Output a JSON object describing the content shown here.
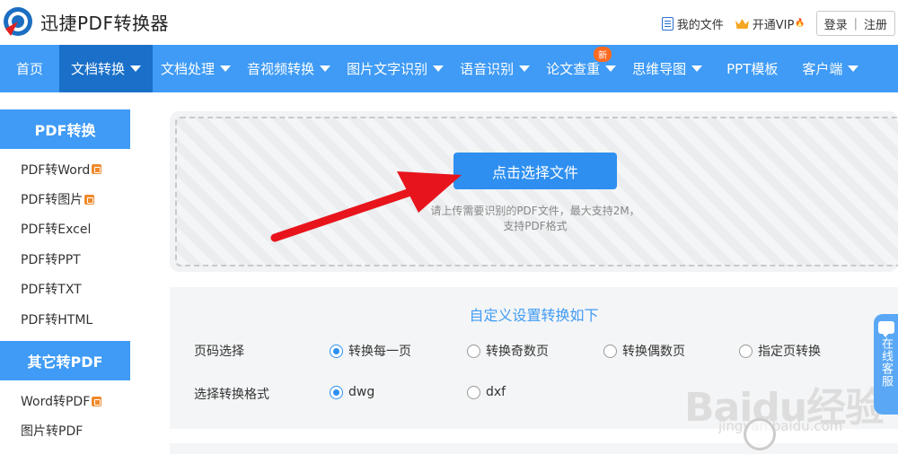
{
  "header": {
    "brand": "迅捷PDF转换器",
    "my_files": "我的文件",
    "vip": "开通VIP",
    "login": "登录",
    "divider": "|",
    "register": "注册"
  },
  "nav": {
    "items": [
      {
        "label": "首页",
        "caret": false
      },
      {
        "label": "文档转换",
        "caret": true,
        "active": true
      },
      {
        "label": "文档处理",
        "caret": true
      },
      {
        "label": "音视频转换",
        "caret": true
      },
      {
        "label": "图片文字识别",
        "caret": true
      },
      {
        "label": "语音识别",
        "caret": true
      },
      {
        "label": "论文查重",
        "caret": true,
        "badge": "新"
      },
      {
        "label": "思维导图",
        "caret": true
      },
      {
        "label": "PPT模板",
        "caret": false
      },
      {
        "label": "客户端",
        "caret": true
      }
    ]
  },
  "sidebar": {
    "pdf_convert_title": "PDF转换",
    "pdf_items": [
      {
        "label": "PDF转Word",
        "vip": true
      },
      {
        "label": "PDF转图片",
        "vip": true
      },
      {
        "label": "PDF转Excel",
        "vip": false
      },
      {
        "label": "PDF转PPT",
        "vip": false
      },
      {
        "label": "PDF转TXT",
        "vip": false
      },
      {
        "label": "PDF转HTML",
        "vip": false
      }
    ],
    "other_title": "其它转PDF",
    "other_items": [
      {
        "label": "Word转PDF",
        "vip": true
      },
      {
        "label": "图片转PDF",
        "vip": false
      }
    ]
  },
  "upload": {
    "button": "点击选择文件",
    "hint_line1": "请上传需要识别的PDF文件，最大支持2M，",
    "hint_line2": "支持PDF格式"
  },
  "settings": {
    "title": "自定义设置转换如下",
    "page_label": "页码选择",
    "page_options": [
      "转换每一页",
      "转换奇数页",
      "转换偶数页",
      "指定页转换"
    ],
    "page_selected": "转换每一页",
    "format_label": "选择转换格式",
    "format_options": [
      "dwg",
      "dxf"
    ],
    "format_selected": "dwg"
  },
  "service": {
    "label": "在线客服"
  },
  "watermark": {
    "text": "Baidu经验",
    "url": "jingyan.baidu.com"
  },
  "colors": {
    "primary": "#3f9bf5",
    "active_nav": "#1a70c8",
    "button": "#2e8ff0",
    "badge": "#ff6a21",
    "arrow": "#e8141c"
  }
}
